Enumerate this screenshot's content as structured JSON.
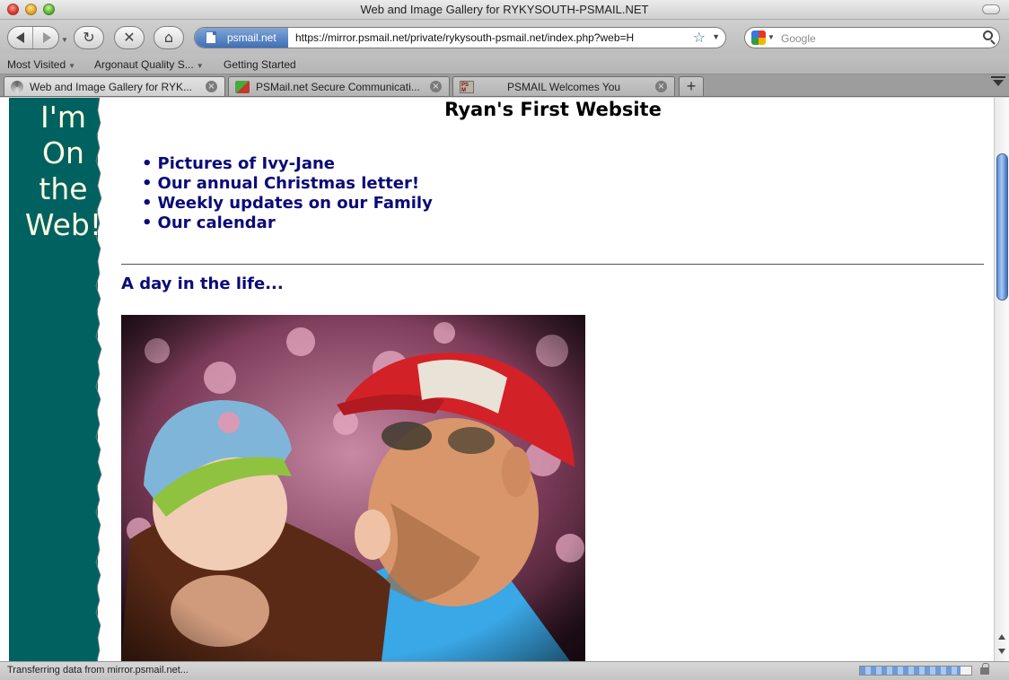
{
  "window": {
    "title": "Web and Image Gallery for RYKYSOUTH-PSMAIL.NET"
  },
  "toolbar": {
    "site_identity": "psmail.net",
    "url": "https://mirror.psmail.net/private/rykysouth-psmail.net/index.php?web=H",
    "search_placeholder": "Google"
  },
  "bookmarks": [
    {
      "label": "Most Visited",
      "has_menu": true
    },
    {
      "label": "Argonaut Quality S...",
      "has_menu": true
    },
    {
      "label": "Getting Started",
      "has_menu": false
    }
  ],
  "tabs": [
    {
      "label": "Web and Image Gallery for RYK...",
      "active": true,
      "icon": "loading-spinner-icon"
    },
    {
      "label": "PSMail.net Secure Communicati...",
      "active": false,
      "icon": "network-favicon-icon"
    },
    {
      "label": "PSMAIL Welcomes You",
      "active": false,
      "icon": "psmail-favicon-icon"
    }
  ],
  "page": {
    "sidebar_lines": [
      "I'm",
      "On",
      "the",
      "Web!"
    ],
    "title": "Ryan's First Website",
    "links": [
      "Pictures of Ivy-Jane",
      "Our annual Christmas letter!",
      "Weekly updates on our Family",
      "Our calendar"
    ],
    "section_heading": "A day in the life...",
    "photo_icon": "family-photo-icon"
  },
  "status": {
    "text": "Transferring data from mirror.psmail.net...",
    "progress": 0.9
  },
  "colors": {
    "sidebar_teal": "#006161",
    "sidebar_text": "#fffbe0",
    "link_navy": "#0a0a78",
    "accent_blue": "#3f6fb8"
  }
}
